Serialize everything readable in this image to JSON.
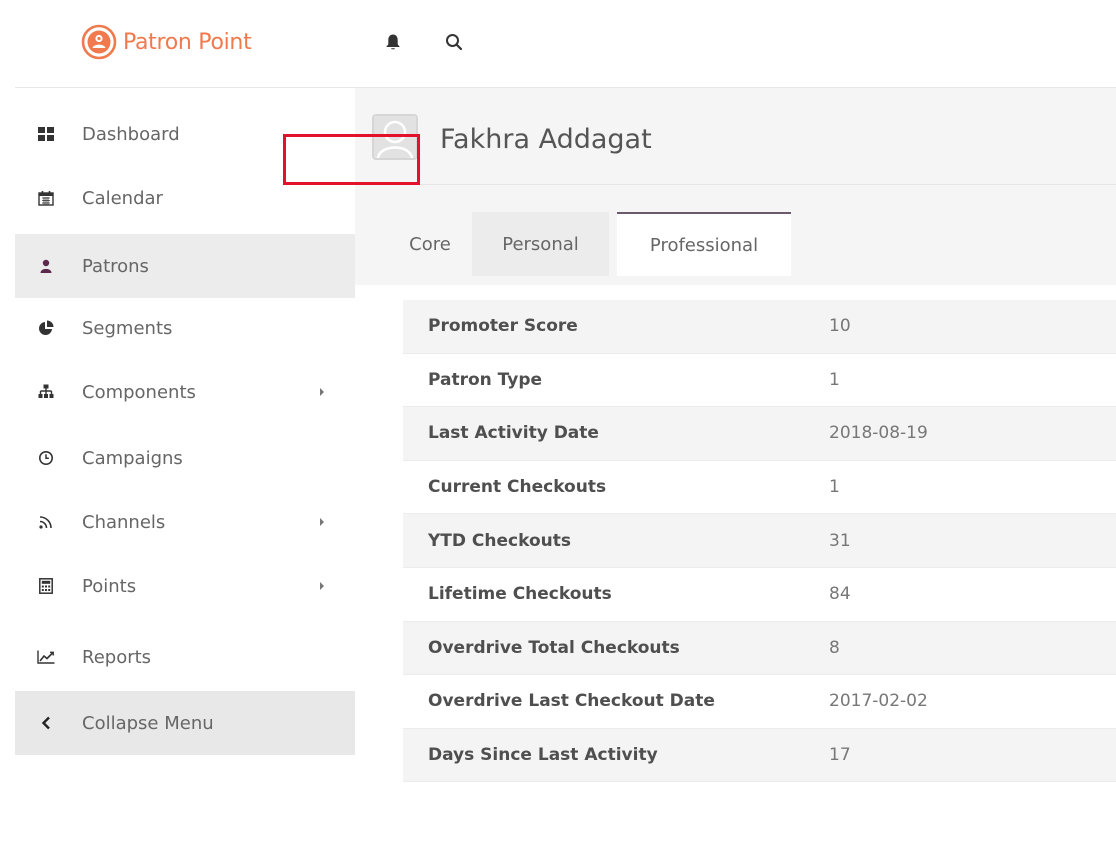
{
  "brand": {
    "name_part1": "Patron",
    "name_part2": "Point",
    "accent_color": "#f07a4d"
  },
  "topbar": {
    "icons": [
      "bell-icon",
      "search-icon"
    ]
  },
  "sidebar": {
    "items": [
      {
        "label": "Dashboard",
        "icon": "dashboard-icon",
        "submenu": false,
        "active": false
      },
      {
        "label": "Calendar",
        "icon": "calendar-icon",
        "submenu": false,
        "active": false
      },
      {
        "label": "Patrons",
        "icon": "user-icon",
        "submenu": false,
        "active": true
      },
      {
        "label": "Segments",
        "icon": "pie-chart-icon",
        "submenu": false,
        "active": false
      },
      {
        "label": "Components",
        "icon": "sitemap-icon",
        "submenu": true,
        "active": false
      },
      {
        "label": "Campaigns",
        "icon": "clock-icon",
        "submenu": false,
        "active": false
      },
      {
        "label": "Channels",
        "icon": "rss-icon",
        "submenu": true,
        "active": false
      },
      {
        "label": "Points",
        "icon": "calculator-icon",
        "submenu": true,
        "active": false
      },
      {
        "label": "Reports",
        "icon": "line-chart-icon",
        "submenu": false,
        "active": false
      }
    ],
    "collapse_label": "Collapse Menu"
  },
  "profile": {
    "name": "Fakhra Addagat"
  },
  "tabs": [
    {
      "label": "Core",
      "active": false
    },
    {
      "label": "Personal",
      "active": false
    },
    {
      "label": "Professional",
      "active": true
    }
  ],
  "highlight_color": "#e3122a",
  "fields": [
    {
      "label": "Promoter Score",
      "value": "10"
    },
    {
      "label": "Patron Type",
      "value": "1"
    },
    {
      "label": "Last Activity Date",
      "value": "2018-08-19"
    },
    {
      "label": "Current Checkouts",
      "value": "1"
    },
    {
      "label": "YTD Checkouts",
      "value": "31"
    },
    {
      "label": "Lifetime Checkouts",
      "value": "84"
    },
    {
      "label": "Overdrive Total Checkouts",
      "value": "8"
    },
    {
      "label": "Overdrive Last Checkout Date",
      "value": "2017-02-02"
    },
    {
      "label": "Days Since Last Activity",
      "value": "17"
    }
  ]
}
